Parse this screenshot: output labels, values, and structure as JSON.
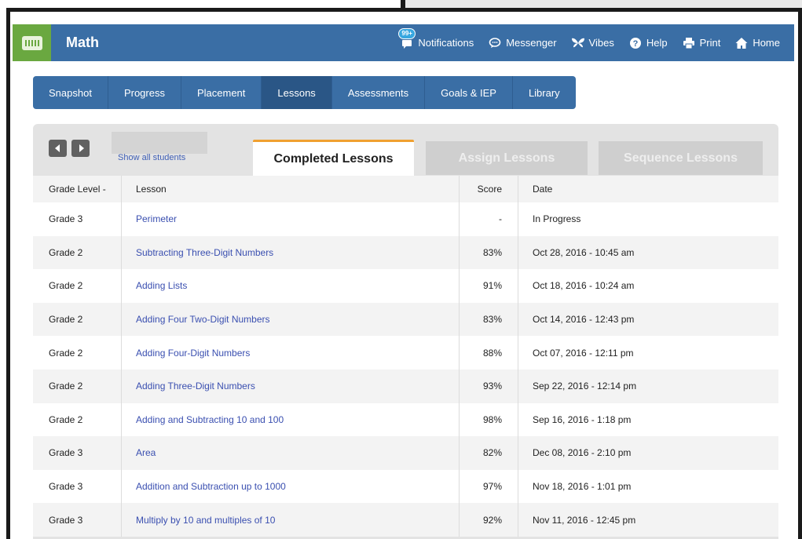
{
  "app": {
    "title": "Math"
  },
  "header_nav": [
    {
      "label": "Notifications",
      "icon": "notifications-icon",
      "badge": "99+"
    },
    {
      "label": "Messenger",
      "icon": "messenger-icon"
    },
    {
      "label": "Vibes",
      "icon": "vibes-icon"
    },
    {
      "label": "Help",
      "icon": "help-icon"
    },
    {
      "label": "Print",
      "icon": "print-icon"
    },
    {
      "label": "Home",
      "icon": "home-icon"
    }
  ],
  "tabs": [
    {
      "label": "Snapshot",
      "active": false
    },
    {
      "label": "Progress",
      "active": false
    },
    {
      "label": "Placement",
      "active": false
    },
    {
      "label": "Lessons",
      "active": true
    },
    {
      "label": "Assessments",
      "active": false
    },
    {
      "label": "Goals & IEP",
      "active": false
    },
    {
      "label": "Library",
      "active": false
    }
  ],
  "panel": {
    "show_all": "Show all students",
    "subtabs": {
      "completed": "Completed Lessons",
      "assign": "Assign Lessons",
      "sequence": "Sequence Lessons"
    }
  },
  "table": {
    "headers": {
      "grade": "Grade Level",
      "sort_indicator": "-",
      "lesson": "Lesson",
      "score": "Score",
      "date": "Date"
    },
    "rows": [
      {
        "grade": "Grade 3",
        "lesson": "Perimeter",
        "score": "-",
        "date": "In Progress"
      },
      {
        "grade": "Grade 2",
        "lesson": "Subtracting Three-Digit Numbers",
        "score": "83%",
        "date": "Oct 28, 2016 - 10:45 am"
      },
      {
        "grade": "Grade 2",
        "lesson": "Adding Lists",
        "score": "91%",
        "date": "Oct 18, 2016 - 10:24 am"
      },
      {
        "grade": "Grade 2",
        "lesson": "Adding Four Two-Digit Numbers",
        "score": "83%",
        "date": "Oct 14, 2016 - 12:43 pm"
      },
      {
        "grade": "Grade 2",
        "lesson": "Adding Four-Digit Numbers",
        "score": "88%",
        "date": "Oct 07, 2016 - 12:11 pm"
      },
      {
        "grade": "Grade 2",
        "lesson": "Adding Three-Digit Numbers",
        "score": "93%",
        "date": "Sep 22, 2016 - 12:14 pm"
      },
      {
        "grade": "Grade 2",
        "lesson": "Adding and Subtracting 10 and 100",
        "score": "98%",
        "date": "Sep 16, 2016 - 1:18 pm"
      },
      {
        "grade": "Grade 3",
        "lesson": "Area",
        "score": "82%",
        "date": "Dec 08, 2016 - 2:10 pm"
      },
      {
        "grade": "Grade 3",
        "lesson": "Addition and Subtraction up to 1000",
        "score": "97%",
        "date": "Nov 18, 2016 - 1:01 pm"
      },
      {
        "grade": "Grade 3",
        "lesson": "Multiply by 10 and multiples of 10",
        "score": "92%",
        "date": "Nov 11, 2016 - 12:45 pm"
      }
    ]
  },
  "colors": {
    "header": "#3a6ea5",
    "app_badge": "#6aa840",
    "active_tab_accent": "#f0a030",
    "link": "#3a4fb0"
  }
}
